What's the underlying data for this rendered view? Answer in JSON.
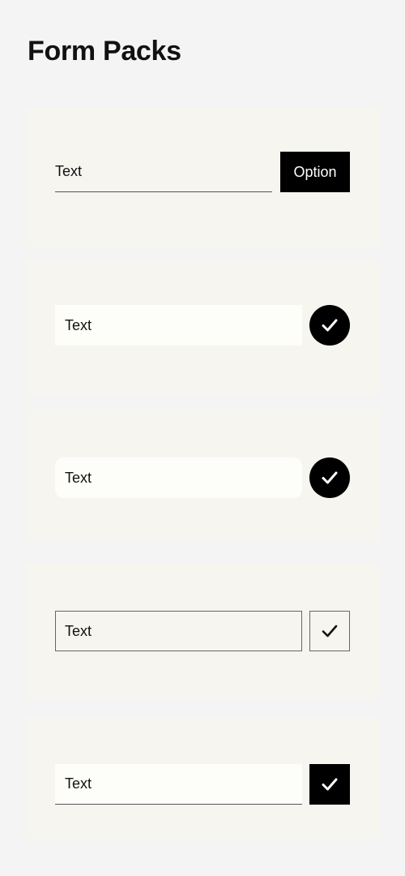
{
  "header": {
    "title": "Form Packs"
  },
  "packs": [
    {
      "input_value": "Text",
      "button_label": "Option"
    },
    {
      "input_value": "Text",
      "action_icon": "check-icon"
    },
    {
      "input_value": "Text",
      "action_icon": "check-icon"
    },
    {
      "input_value": "Text",
      "action_icon": "check-icon"
    },
    {
      "input_value": "Text",
      "action_icon": "check-icon"
    }
  ],
  "colors": {
    "background": "#f4f4f4",
    "card": "#f6f5f0",
    "input_fill": "#fdfdfa",
    "accent": "#000000"
  }
}
